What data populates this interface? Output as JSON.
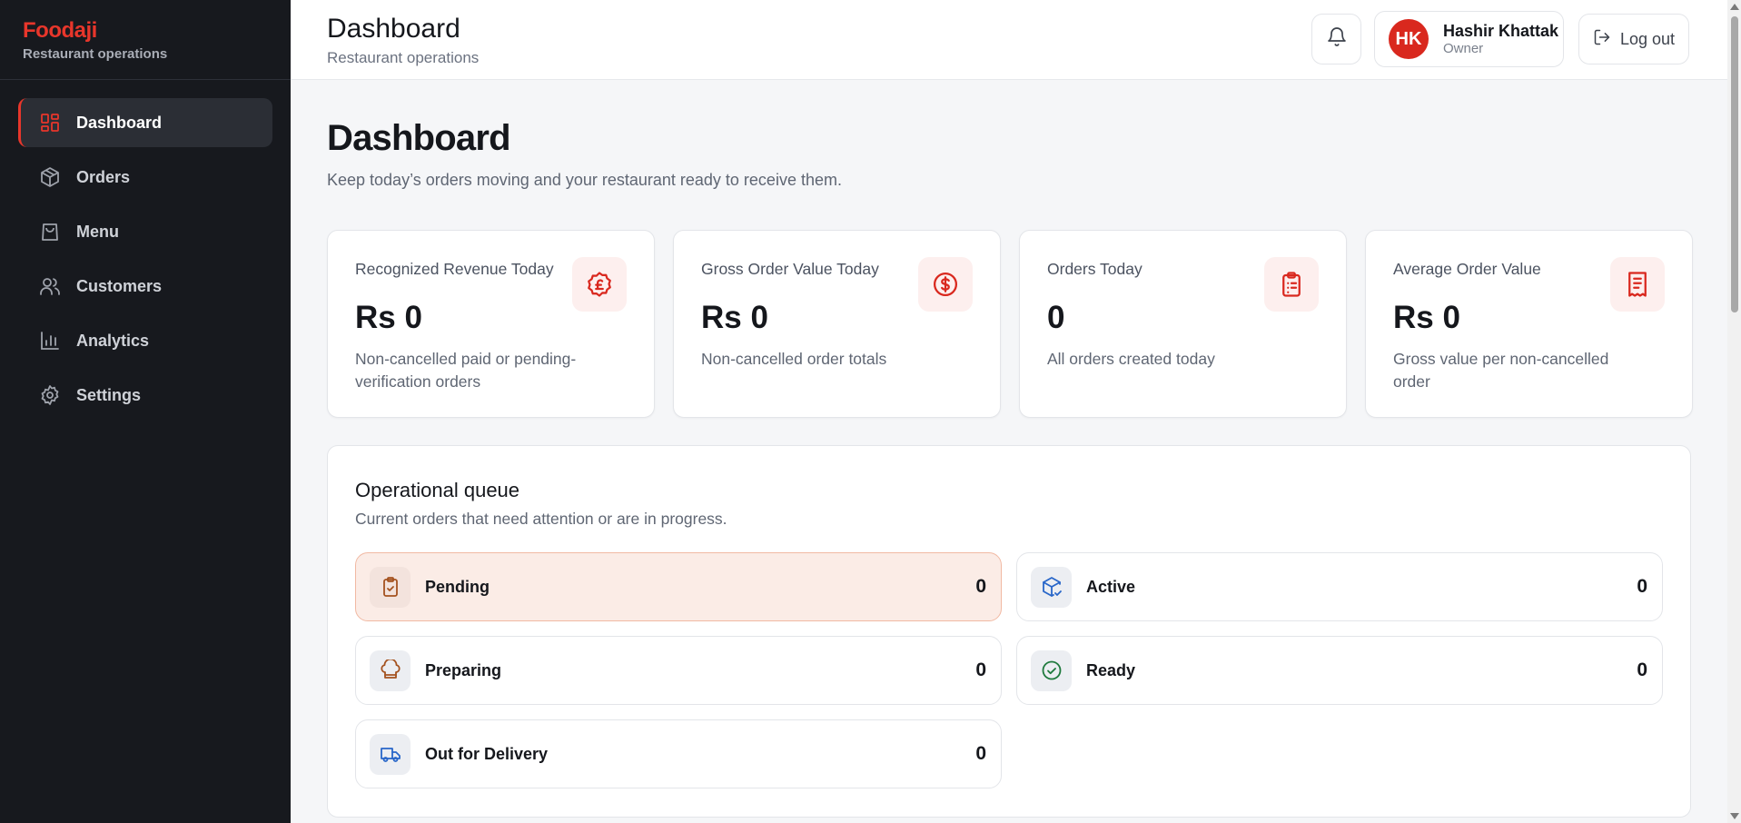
{
  "brand": {
    "name": "Foodaji",
    "subtitle": "Restaurant operations"
  },
  "sidebar": {
    "items": [
      {
        "label": "Dashboard",
        "icon": "dashboard-icon",
        "active": true
      },
      {
        "label": "Orders",
        "icon": "box-icon"
      },
      {
        "label": "Menu",
        "icon": "bag-icon"
      },
      {
        "label": "Customers",
        "icon": "users-icon"
      },
      {
        "label": "Analytics",
        "icon": "bar-chart-icon"
      },
      {
        "label": "Settings",
        "icon": "gear-icon"
      }
    ]
  },
  "header": {
    "title": "Dashboard",
    "subtitle": "Restaurant operations",
    "user": {
      "initials": "HK",
      "name": "Hashir Khattak",
      "role": "Owner"
    },
    "logout_label": "Log out"
  },
  "page": {
    "title": "Dashboard",
    "subtitle": "Keep today’s orders moving and your restaurant ready to receive them."
  },
  "stats": [
    {
      "label": "Recognized Revenue Today",
      "value": "Rs 0",
      "description": "Non-cancelled paid or pending-verification orders",
      "icon": "pound-coin-icon"
    },
    {
      "label": "Gross Order Value Today",
      "value": "Rs 0",
      "description": "Non-cancelled order totals",
      "icon": "dollar-coin-icon"
    },
    {
      "label": "Orders Today",
      "value": "0",
      "description": "All orders created today",
      "icon": "clipboard-list-icon"
    },
    {
      "label": "Average Order Value",
      "value": "Rs 0",
      "description": "Gross value per non-cancelled order",
      "icon": "receipt-icon"
    }
  ],
  "queue": {
    "title": "Operational queue",
    "subtitle": "Current orders that need attention or are in progress.",
    "items": [
      {
        "label": "Pending",
        "count": "0",
        "icon": "clipboard-check-icon"
      },
      {
        "label": "Active",
        "count": "0",
        "icon": "package-check-icon"
      },
      {
        "label": "Preparing",
        "count": "0",
        "icon": "chef-hat-icon"
      },
      {
        "label": "Ready",
        "count": "0",
        "icon": "check-circle-icon"
      },
      {
        "label": "Out for Delivery",
        "count": "0",
        "icon": "truck-icon"
      }
    ]
  },
  "colors": {
    "accent": "#e8362b",
    "sidebar_bg": "#17191e",
    "highlight_bg": "#fbece6"
  }
}
